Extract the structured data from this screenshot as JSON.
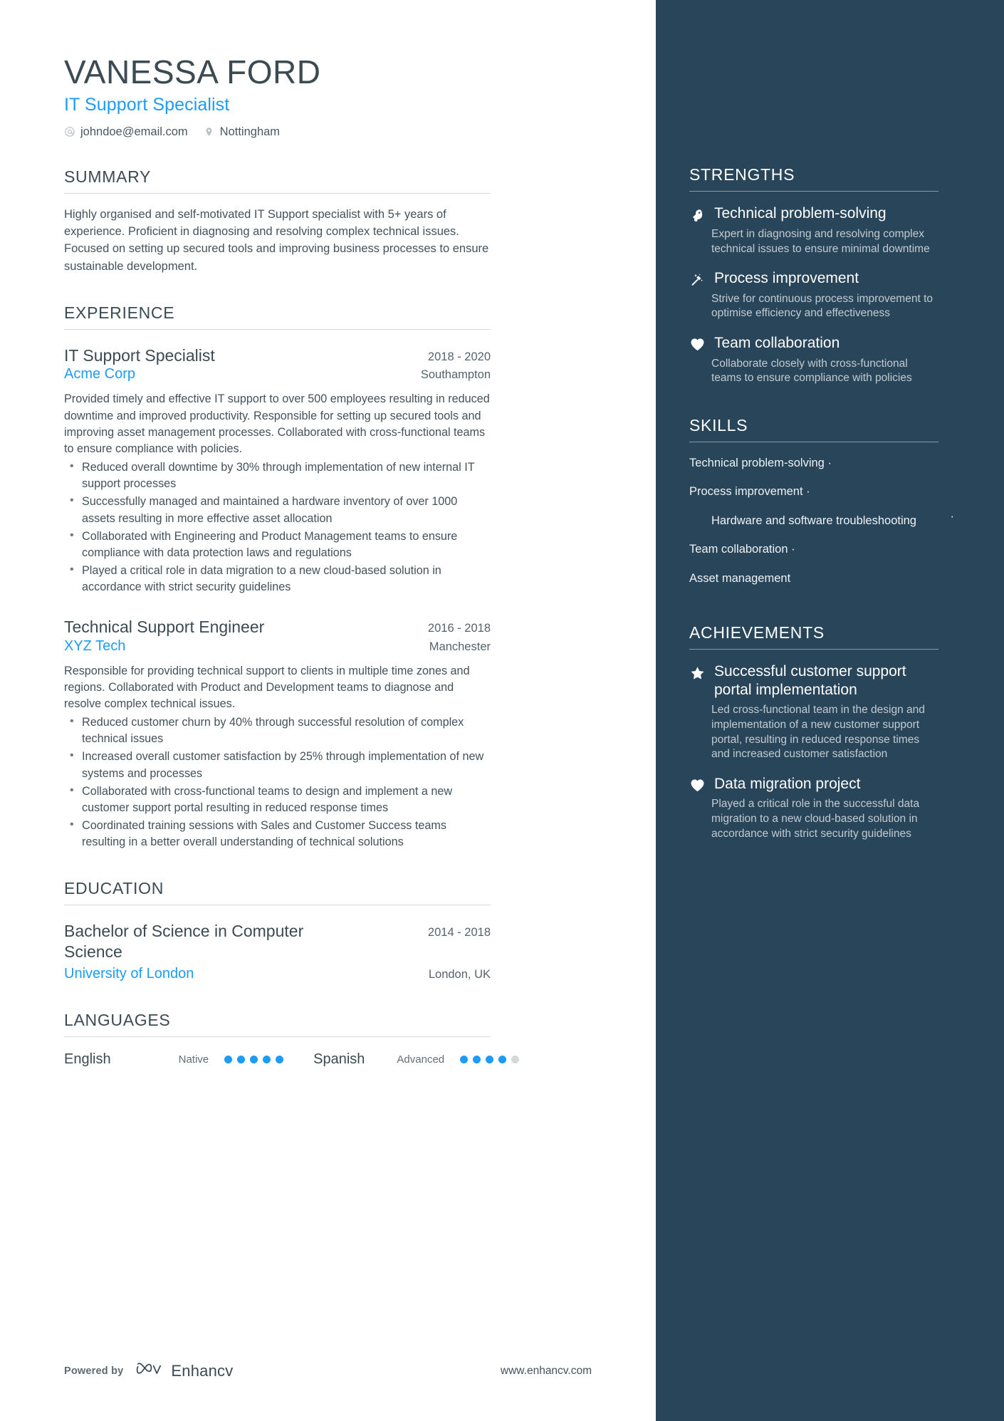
{
  "theme": {
    "accent": "#1d9bf8",
    "sidebar_bg": "#294559",
    "text": "#3c4a52",
    "muted": "#c2cbd2"
  },
  "header": {
    "name": "VANESSA FORD",
    "title": "IT Support Specialist",
    "email": "johndoe@email.com",
    "email_icon": "at-icon",
    "location": "Nottingham",
    "location_icon": "map-pin-icon"
  },
  "summary": {
    "heading": "SUMMARY",
    "text": "Highly organised and self-motivated IT Support specialist with 5+ years of experience. Proficient in diagnosing and resolving complex technical issues. Focused on setting up secured tools and improving business processes to ensure sustainable development."
  },
  "experience": {
    "heading": "EXPERIENCE",
    "entries": [
      {
        "title": "IT Support Specialist",
        "date": "2018 - 2020",
        "org": "Acme Corp",
        "location": "Southampton",
        "description": "Provided timely and effective IT support to over 500 employees resulting in reduced downtime and improved productivity. Responsible for setting up secured tools and improving asset management processes. Collaborated with cross-functional teams to ensure compliance with policies.",
        "bullets": [
          "Reduced overall downtime by 30% through implementation of new internal IT support processes",
          "Successfully managed and maintained a hardware inventory of over 1000 assets resulting in more effective asset allocation",
          "Collaborated with Engineering and Product Management teams to ensure compliance with data protection laws and regulations",
          "Played a critical role in data migration to a new cloud-based solution in accordance with strict security guidelines"
        ]
      },
      {
        "title": "Technical Support Engineer",
        "date": "2016 - 2018",
        "org": "XYZ Tech",
        "location": "Manchester",
        "description": "Responsible for providing technical support to clients in multiple time zones and regions. Collaborated with Product and Development teams to diagnose and resolve complex technical issues.",
        "bullets": [
          "Reduced customer churn by 40% through successful resolution of complex technical issues",
          "Increased overall customer satisfaction by 25% through implementation of new systems and processes",
          "Collaborated with cross-functional teams to design and implement a new customer support portal resulting in reduced response times",
          "Coordinated training sessions with Sales and Customer Success teams resulting in a better overall understanding of technical solutions"
        ]
      }
    ]
  },
  "education": {
    "heading": "EDUCATION",
    "entries": [
      {
        "title": "Bachelor of Science in Computer Science",
        "date": "2014 - 2018",
        "org": "University of London",
        "location": "London, UK"
      }
    ]
  },
  "languages": {
    "heading": "LANGUAGES",
    "items": [
      {
        "name": "English",
        "level": "Native",
        "rating": 5,
        "max": 5
      },
      {
        "name": "Spanish",
        "level": "Advanced",
        "rating": 4,
        "max": 5
      }
    ]
  },
  "footer": {
    "powered_by": "Powered by",
    "brand": "Enhancv",
    "brand_icon": "enhancv-logo-icon",
    "url": "www.enhancv.com"
  },
  "strengths": {
    "heading": "STRENGTHS",
    "items": [
      {
        "icon": "head-brain-icon",
        "name": "Technical problem-solving",
        "desc": "Expert in diagnosing and resolving complex technical issues to ensure minimal downtime"
      },
      {
        "icon": "magic-wand-icon",
        "name": "Process improvement",
        "desc": "Strive for continuous process improvement to optimise efficiency and effectiveness"
      },
      {
        "icon": "heart-icon",
        "name": "Team collaboration",
        "desc": "Collaborate closely with cross-functional teams to ensure compliance with policies"
      }
    ]
  },
  "skills": {
    "heading": "SKILLS",
    "separator": "·",
    "items": [
      "Technical problem-solving",
      "Process improvement",
      "Hardware and software troubleshooting",
      "Team collaboration",
      "Asset management"
    ]
  },
  "achievements": {
    "heading": "ACHIEVEMENTS",
    "items": [
      {
        "icon": "star-icon",
        "name": "Successful customer support portal implementation",
        "desc": "Led cross-functional team in the design and implementation of a new customer support portal, resulting in reduced response times and increased customer satisfaction"
      },
      {
        "icon": "heart-icon",
        "name": "Data migration project",
        "desc": "Played a critical role in the successful data migration to a new cloud-based solution in accordance with strict security guidelines"
      }
    ]
  }
}
